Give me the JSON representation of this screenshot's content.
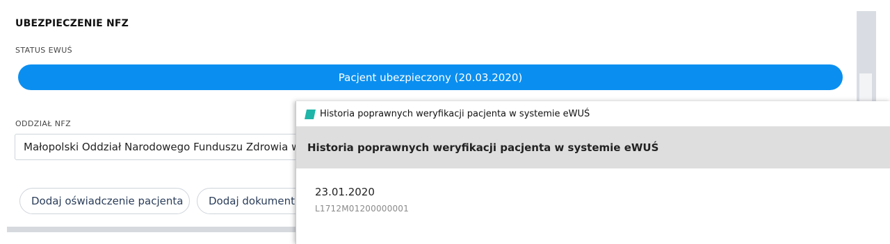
{
  "section": {
    "title": "UBEZPIECZENIE NFZ",
    "status_label": "STATUS EWUŚ",
    "status_value": "Pacjent ubezpieczony (20.03.2020)",
    "division_label": "ODDZIAŁ NFZ",
    "division_value": "Małopolski Oddział Narodowego Funduszu Zdrowia w"
  },
  "buttons": {
    "add_statement": "Dodaj oświadczenie pacjenta",
    "add_document": "Dodaj dokument"
  },
  "popup": {
    "window_title": "Historia poprawnych weryfikacji pacjenta w systemie eWUŚ",
    "header": "Historia poprawnych weryfikacji pacjenta w systemie eWUŚ",
    "entries": [
      {
        "date": "23.01.2020",
        "id": "L1712M01200000001"
      }
    ]
  },
  "colors": {
    "status_bar": "#0a8ff0",
    "app_icon": "#1fb5a8"
  },
  "icons": {
    "app": "app-icon"
  }
}
